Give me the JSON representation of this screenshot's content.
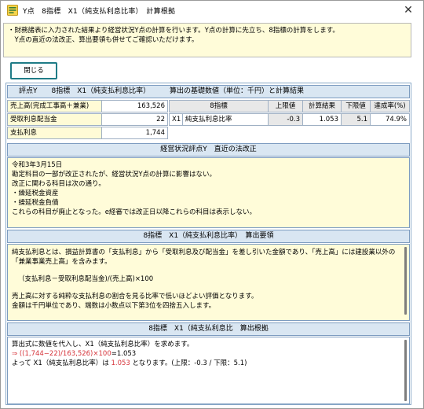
{
  "window": {
    "title": "Y点　8指標　X1（純支払利息比率）　計算根拠",
    "close_glyph": "✕"
  },
  "info": {
    "lines": [
      "・財務諸表に入力された結果より経営状況Y点の計算を行います。Y点の計算に先立ち、8指標の計算をします。",
      "　Y点の直近の法改正、算出要領も併せてご確認いただけます。"
    ]
  },
  "buttons": {
    "close_label": "閉じる"
  },
  "section1": {
    "left_title": "評点Y　　8指標　X1（純支払利息比率）",
    "right_title": "算出の基礎数値（単位：千円）と計算結果",
    "rows": [
      {
        "label": "売上高(完成工事高＋兼業)",
        "value": "163,526"
      },
      {
        "label": "受取利息配当金",
        "value": "22"
      },
      {
        "label": "支払利息",
        "value": "1,744"
      }
    ],
    "result": {
      "headers": [
        "8指標",
        "上限値",
        "計算結果",
        "下限値",
        "達成率(%)"
      ],
      "code": "X1",
      "name": "純支払利息比率",
      "upper": "-0.3",
      "calc": "1.053",
      "lower": "5.1",
      "rate": "74.9%"
    }
  },
  "section2": {
    "title": "経営状況評点Y　直近の法改正",
    "lines": [
      "令和3年3月15日",
      "勘定科目の一部が改正されたが、経営状況Y点の計算に影響はない。",
      "改正に関わる科目は次の通り。",
      "・繰延税金資産",
      "・繰延税金負債",
      "これらの科目が廃止となった。e経審では改正日以降これらの科目は表示しない。"
    ]
  },
  "section3": {
    "title": "8指標　X1（純支払利息比率）　算出要領",
    "para1": "純支払利息とは、損益計算書の「支払利息」から「受取利息及び配当金」を差し引いた金額であり、「売上高」には建設業以外の「兼業事業売上高」を含みます。",
    "formula": "（支払利息－受取利息配当金)/(売上高)×100",
    "line3": "売上高に対する純粋な支払利息の割合を見る比率で低いほどよい評価となります。",
    "line4": "金額は千円単位であり、端数は小数点以下第3位を四捨五入します。"
  },
  "section4": {
    "title": "8指標　X1（純支払利息比　算出根拠",
    "line1": "算出式に数値を代入し、X1（純支払利息比率）を求めます。",
    "formula_arrow": "⇒",
    "formula_red": "((1,744−22)/163,526)×100",
    "formula_rest": "=1.053",
    "result_prefix": "よって X1（純支払利息比率）は ",
    "result_value": "1.053",
    "result_suffix": " となります。(上限：-0.3 / 下限：5.1)"
  },
  "colors": {
    "accent": "#1f7b86",
    "header_bg": "#d9e6f2",
    "panel_bg": "#fffcd9",
    "highlight": "#d6333a"
  }
}
